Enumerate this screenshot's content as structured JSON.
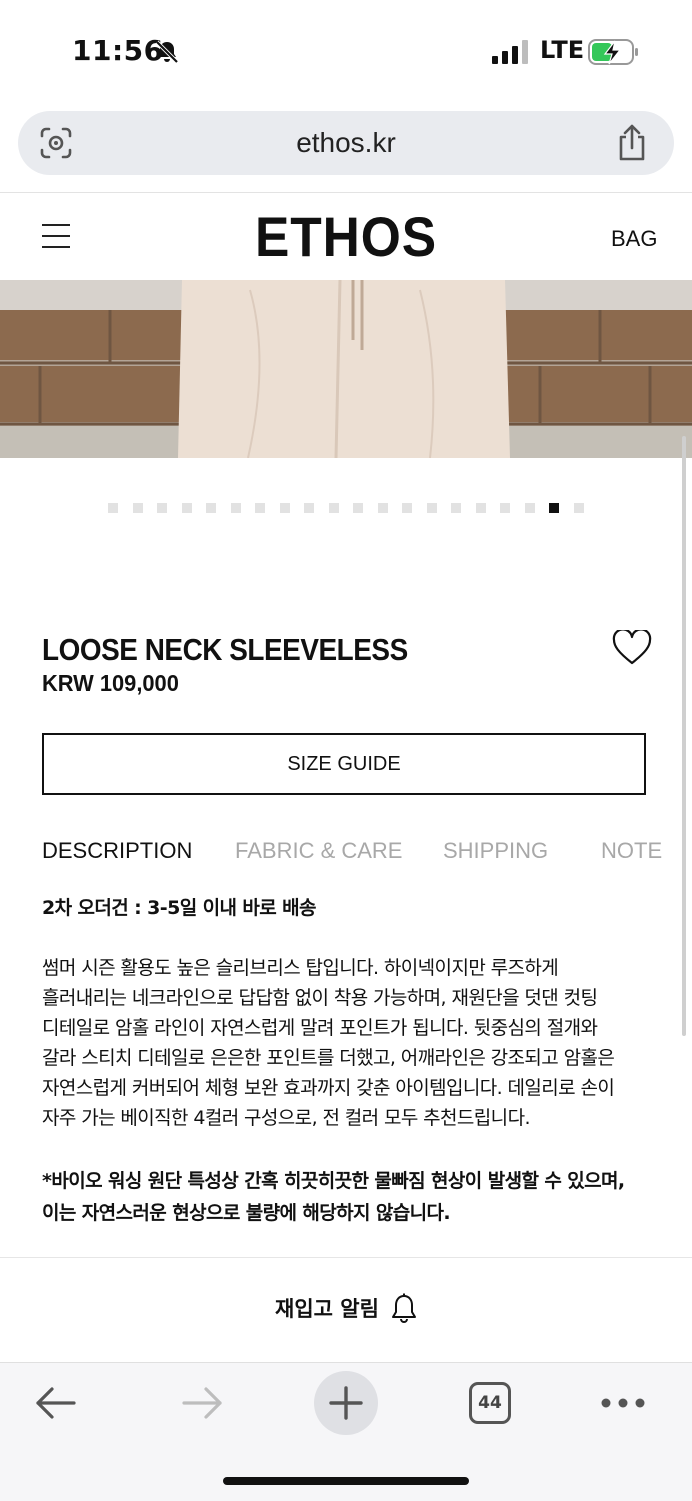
{
  "status": {
    "time": "11:56",
    "network": "LTE"
  },
  "browser": {
    "url": "ethos.kr",
    "tab_count": "44"
  },
  "header": {
    "logo": "ETHOS",
    "bag_label": "BAG"
  },
  "gallery": {
    "total": 20,
    "active_index": 18
  },
  "product": {
    "name": "LOOSE NECK SLEEVELESS",
    "price": "KRW 109,000",
    "size_guide_label": "SIZE GUIDE"
  },
  "tabs": [
    {
      "label": "DESCRIPTION",
      "active": true
    },
    {
      "label": "FABRIC & CARE",
      "active": false
    },
    {
      "label": "SHIPPING",
      "active": false
    },
    {
      "label": "NOTE",
      "active": false
    }
  ],
  "description": {
    "notice": "2차 오더건 : 3-5일 이내 바로 배송",
    "body": [
      "썸머 시즌 활용도 높은 슬리브리스 탑입니다. 하이넥이지만 루즈하게",
      "흘러내리는 네크라인으로 답답함 없이 착용 가능하며, 재원단을 덧댄 컷팅",
      "디테일로 암홀 라인이 자연스럽게 말려 포인트가 됩니다. 뒷중심의 절개와",
      "갈라 스티치 디테일로 은은한 포인트를 더했고, 어깨라인은 강조되고 암홀은",
      "자연스럽게 커버되어 체형 보완 효과까지 갖춘 아이템입니다. 데일리로 손이",
      "자주 가는 베이직한 4컬러 구성으로, 전 컬러 모두 추천드립니다."
    ],
    "warning": [
      "*바이오 워싱 원단 특성상 간혹 히끗히끗한 물빠짐 현상이 발생할 수 있으며,",
      "이는 자연스러운 현상으로 불량에 해당하지 않습니다."
    ]
  },
  "restock": {
    "label": "재입고 알림"
  }
}
